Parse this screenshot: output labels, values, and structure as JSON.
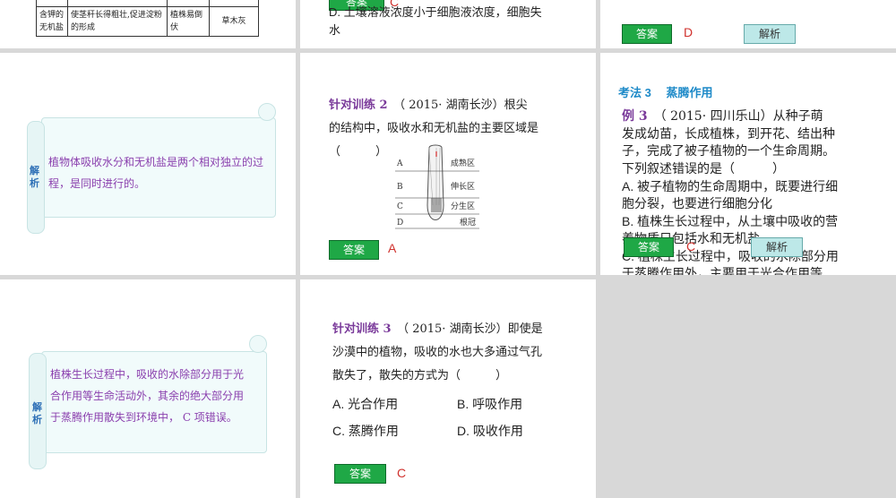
{
  "slide1": {
    "cell_a": "含钾的无机盐",
    "cell_b": "使茎秆长得粗壮,促进淀粉的形成",
    "cell_c": "植株易倒伏",
    "cell_d": "草木灰"
  },
  "slide2": {
    "line1": "D. 土壤溶液浓度小于细胞液浓度，细胞失",
    "line2": "水",
    "answer_label": "答案",
    "answer_value": "C"
  },
  "slide3": {
    "answer_label": "答案",
    "answer_value": "D",
    "jiexi_label": "解析"
  },
  "slide4": {
    "scroll_title": "解析",
    "text": "植物体吸收水分和无机盐是两个相对独立的过程，是同时进行的。"
  },
  "slide5": {
    "heading": "针对训练 2",
    "source": "（ 2015· 湖南长沙）根尖",
    "q_line2": "的结构中，吸收水和无机盐的主要区域是",
    "q_line3": "（　　　）",
    "diagram": {
      "labels": [
        "A",
        "B",
        "C",
        "D"
      ],
      "zones": [
        "成熟区",
        "伸长区",
        "分生区",
        "根冠"
      ]
    },
    "answer_label": "答案",
    "answer_value": "A"
  },
  "slide6": {
    "section": "考法 3　 蒸腾作用",
    "example": "例 3",
    "q_line1": "（ 2015· 四川乐山）从种子萌",
    "q_line2": "发成幼苗，长成植株，到开花、结出种",
    "q_line3": "子，完成了被子植物的一个生命周期。",
    "q_line4": "下列叙述错误的是（　　　）",
    "optA1": "A. 被子植物的生命周期中，既要进行细",
    "optA2": "胞分裂，也要进行细胞分化",
    "optB1": "B. 植株生长过程中，从土壤中吸收的营",
    "optB2": "养物质只包括水和无机盐",
    "optC1": "C. 植株生长过程中，吸收的水除部分用",
    "optC2": "于蒸腾作用外，主要用于光合作用等",
    "answer_label": "答案",
    "answer_value": "C",
    "jiexi_label": "解析"
  },
  "slide7": {
    "scroll_title": "解析",
    "text": "植株生长过程中，吸收的水除部分用于光合作用等生命活动外，其余的绝大部分用于蒸腾作用散失到环境中， C 项错误。"
  },
  "slide8": {
    "heading": "针对训练 3",
    "source": "（ 2015· 湖南长沙）即使是",
    "q_line2": "沙漠中的植物，吸收的水也大多通过气孔",
    "q_line3": "散失了，散失的方式为（　　　）",
    "optA": "A. 光合作用",
    "optB": "B. 呼吸作用",
    "optC": "C. 蒸腾作用",
    "optD": "D. 吸收作用",
    "answer_label": "答案",
    "answer_value": "C"
  }
}
